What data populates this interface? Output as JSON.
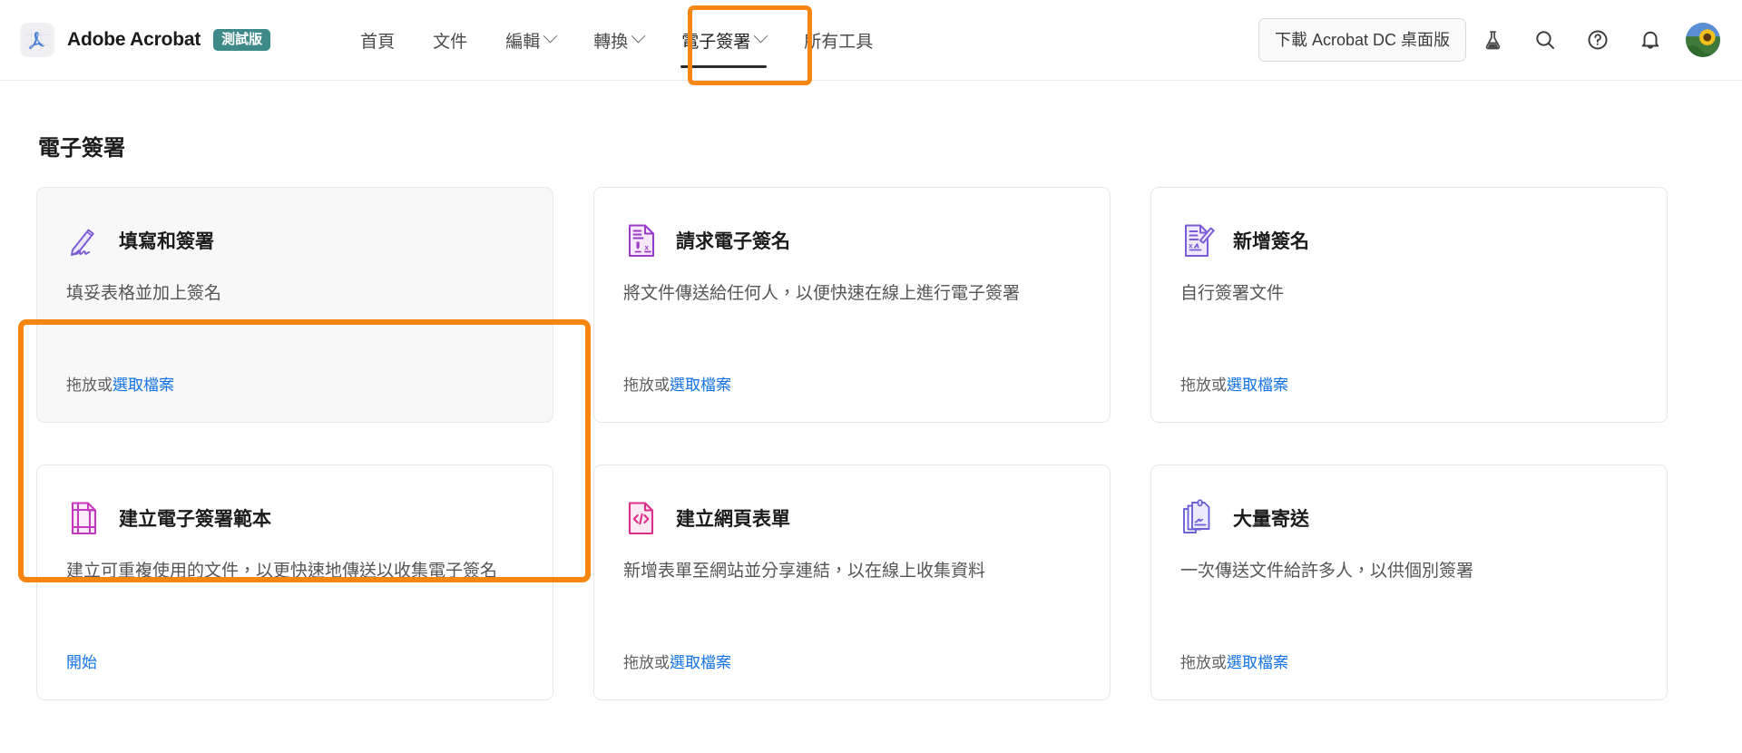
{
  "header": {
    "app_name": "Adobe Acrobat",
    "beta_badge": "測試版",
    "logo_icon": "acrobat-logo-icon",
    "nav": [
      {
        "label": "首頁",
        "has_caret": false,
        "active": false
      },
      {
        "label": "文件",
        "has_caret": false,
        "active": false
      },
      {
        "label": "編輯",
        "has_caret": true,
        "active": false
      },
      {
        "label": "轉換",
        "has_caret": true,
        "active": false
      },
      {
        "label": "電子簽署",
        "has_caret": true,
        "active": true
      },
      {
        "label": "所有工具",
        "has_caret": false,
        "active": false
      }
    ],
    "download_button": "下載 Acrobat DC 桌面版",
    "icons": [
      {
        "name": "flask-icon",
        "label": "實驗室"
      },
      {
        "name": "search-icon",
        "label": "搜尋"
      },
      {
        "name": "help-icon",
        "label": "說明"
      },
      {
        "name": "bell-icon",
        "label": "通知"
      }
    ],
    "avatar": "sunflower-avatar"
  },
  "main": {
    "page_title": "電子簽署",
    "cards": [
      {
        "icon": "pen-signature-icon",
        "icon_color": "#7b5cd6",
        "title": "填寫和簽署",
        "description": "填妥表格並加上簽名",
        "action_prefix": "拖放或",
        "action_link": "選取檔案",
        "selected": true
      },
      {
        "icon": "request-signature-document-icon",
        "icon_color": "#9d3bc9",
        "title": "請求電子簽名",
        "description": "將文件傳送給任何人，以便快速在線上進行電子簽署",
        "action_prefix": "拖放或",
        "action_link": "選取檔案",
        "selected": false
      },
      {
        "icon": "add-signature-document-icon",
        "icon_color": "#7b5cd6",
        "title": "新增簽名",
        "description": "自行簽署文件",
        "action_prefix": "拖放或",
        "action_link": "選取檔案",
        "selected": false
      },
      {
        "icon": "template-document-icon",
        "icon_color": "#c33bbd",
        "title": "建立電子簽署範本",
        "description": "建立可重複使用的文件，以更快速地傳送以收集電子簽名",
        "action_prefix": "",
        "action_link": "開始",
        "selected": false
      },
      {
        "icon": "web-form-code-icon",
        "icon_color": "#d9308a",
        "title": "建立網頁表單",
        "description": "新增表單至網站並分享連結，以在線上收集資料",
        "action_prefix": "拖放或",
        "action_link": "選取檔案",
        "selected": false
      },
      {
        "icon": "bulk-send-documents-icon",
        "icon_color": "#6a62d6",
        "title": "大量寄送",
        "description": "一次傳送文件給許多人，以供個別簽署",
        "action_prefix": "拖放或",
        "action_link": "選取檔案",
        "selected": false
      }
    ]
  },
  "highlights": {
    "accent_color": "#f68511",
    "nav_target": "電子簽署",
    "card_target": "填寫和簽署"
  },
  "colors": {
    "link": "#1473e6",
    "badge_teal": "#3e8a89",
    "text_primary": "#1c1c1c",
    "text_secondary": "#555555",
    "border": "#e8e8e8"
  }
}
